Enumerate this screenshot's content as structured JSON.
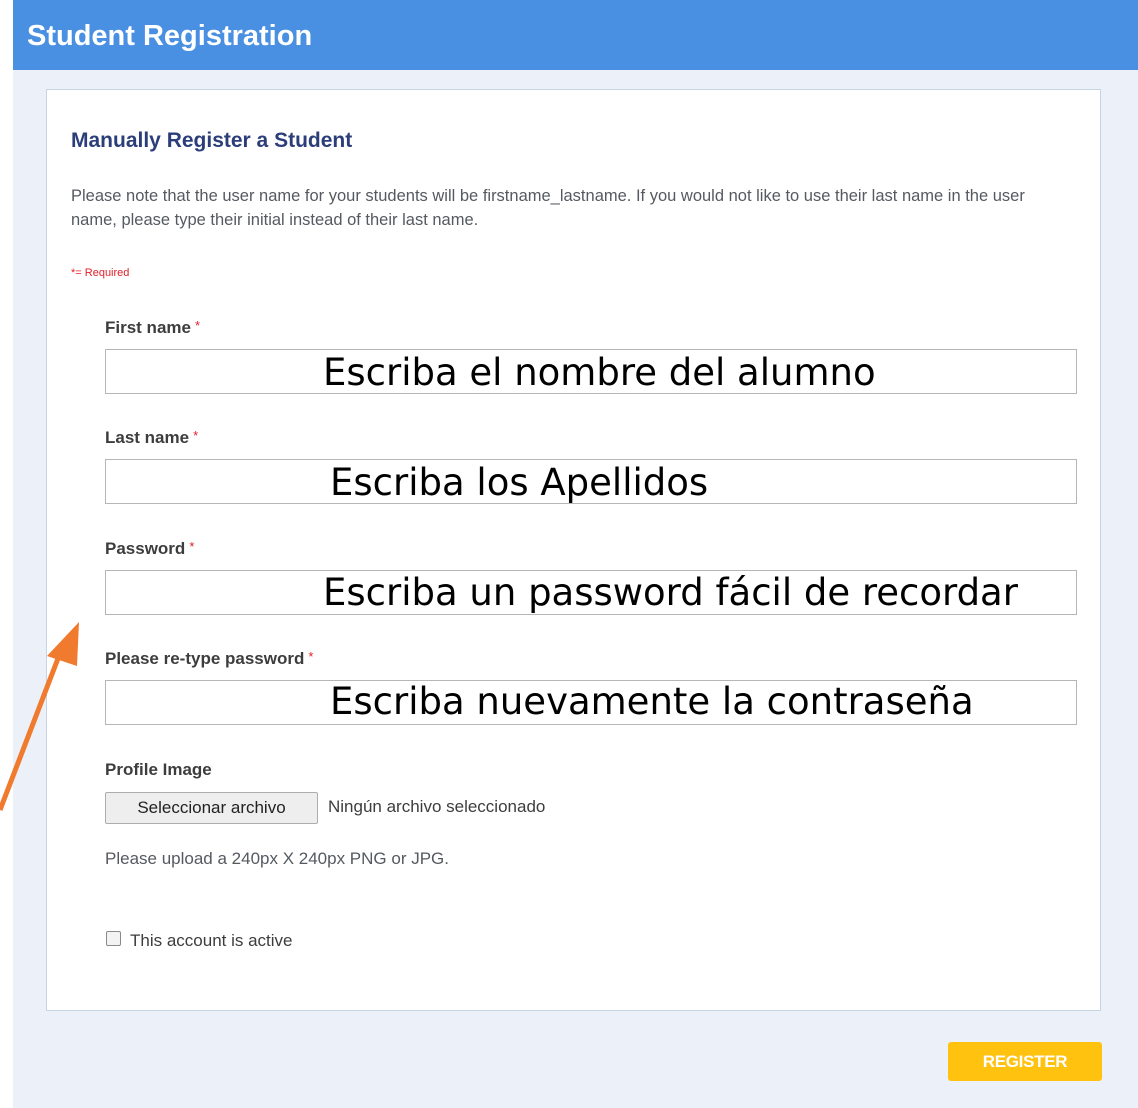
{
  "header": {
    "title": "Student Registration"
  },
  "form": {
    "section_title": "Manually Register a Student",
    "note": "Please note that the user name for your students will be firstname_lastname. If you would not like to use their last name in the user name, please type their initial instead of their last name.",
    "required_note": "*= Required",
    "fields": [
      {
        "label": "First name",
        "required_mark": "*",
        "annotation": "Escriba el nombre del alumno"
      },
      {
        "label": "Last name",
        "required_mark": "*",
        "annotation": "Escriba los Apellidos"
      },
      {
        "label": "Password",
        "required_mark": "*",
        "annotation": "Escriba un password fácil de recordar"
      },
      {
        "label": "Please re-type password",
        "required_mark": "*",
        "annotation": "Escriba nuevamente la contraseña"
      }
    ],
    "profile_image": {
      "label": "Profile Image",
      "button_label": "Seleccionar archivo",
      "status": "Ningún archivo seleccionado",
      "hint": "Please upload a 240px X 240px PNG or JPG."
    },
    "active_checkbox": {
      "label": "This account is active",
      "checked": false
    },
    "register_label": "REGISTER"
  },
  "colors": {
    "header_bg": "#4a90e2",
    "title_color": "#2c3e7a",
    "required_red": "#e0202a",
    "register_bg": "#ffc20e",
    "annotation_arrow": "#f07b2e"
  }
}
